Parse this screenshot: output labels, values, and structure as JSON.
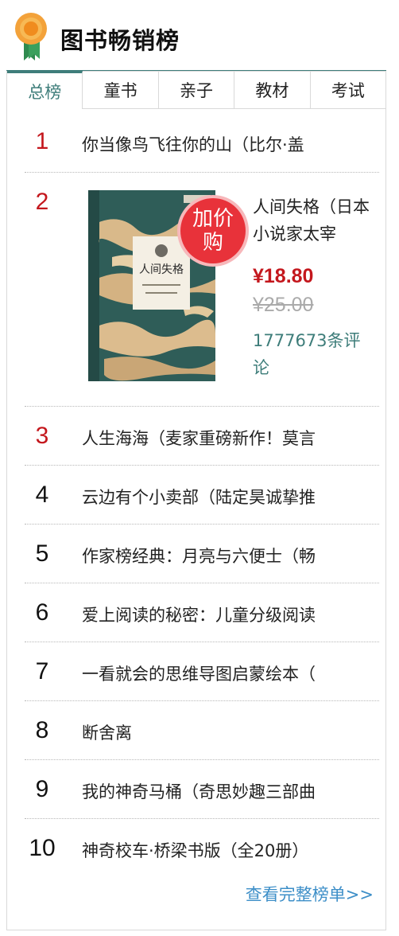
{
  "header": {
    "title": "图书畅销榜",
    "icon": "award-medal-icon"
  },
  "tabs": [
    {
      "label": "总榜",
      "active": true
    },
    {
      "label": "童书",
      "active": false
    },
    {
      "label": "亲子",
      "active": false
    },
    {
      "label": "教材",
      "active": false
    },
    {
      "label": "考试",
      "active": false
    }
  ],
  "featured": {
    "rank": "2",
    "badge": "加价购",
    "badge_line1": "加价",
    "badge_line2": "购",
    "title": "人间失格（日本小说家太宰",
    "price": "¥18.80",
    "original_price": "¥25.00",
    "reviews": "1777673条评论",
    "cover_title": "人间失格"
  },
  "items": [
    {
      "rank": "1",
      "title": "你当像鸟飞往你的山（比尔·盖"
    },
    {
      "rank": "3",
      "title": "人生海海（麦家重磅新作！莫言"
    },
    {
      "rank": "4",
      "title": "云边有个小卖部（陆定昊诚挚推"
    },
    {
      "rank": "5",
      "title": "作家榜经典：月亮与六便士（畅"
    },
    {
      "rank": "6",
      "title": "爱上阅读的秘密：儿童分级阅读"
    },
    {
      "rank": "7",
      "title": "一看就会的思维导图启蒙绘本（"
    },
    {
      "rank": "8",
      "title": "断舍离"
    },
    {
      "rank": "9",
      "title": "我的神奇马桶（奇思妙趣三部曲"
    },
    {
      "rank": "10",
      "title": "神奇校车·桥梁书版（全20册）"
    }
  ],
  "more_link": "查看完整榜单>>",
  "colors": {
    "accent": "#3e7d7a",
    "rank_top": "#c4171d",
    "price": "#c4171d",
    "link": "#3e8fc8",
    "badge": "#e8323a"
  }
}
